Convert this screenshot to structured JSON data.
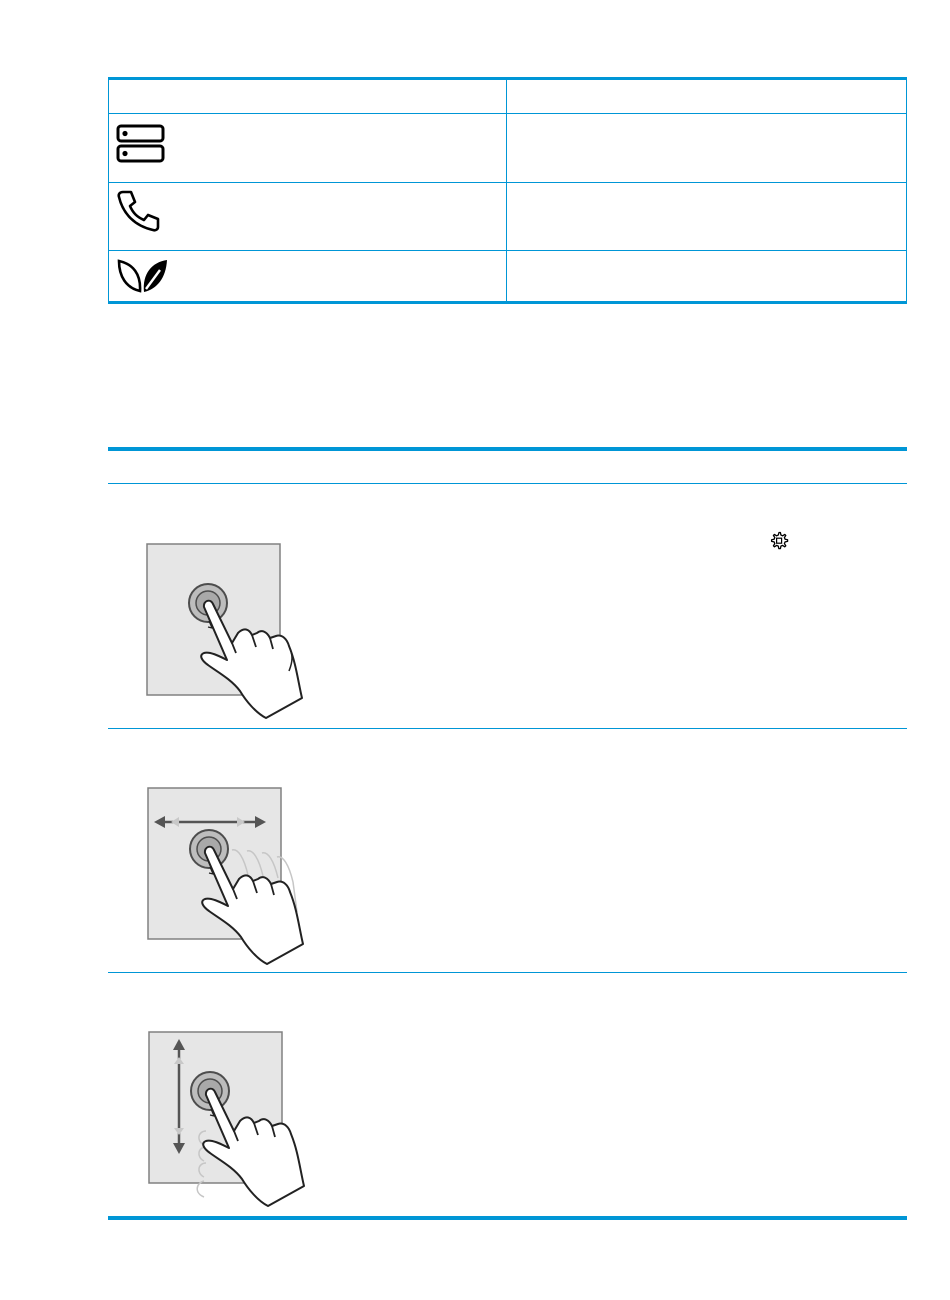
{
  "table_1": {
    "rows": [
      {
        "icon": "device-list-icon"
      },
      {
        "icon": "phone-icon"
      },
      {
        "icon": "leaf-icon"
      }
    ]
  },
  "table_2": {
    "rows": [
      {
        "gesture": "touch-gesture",
        "inline_icon": "settings-gear-icon"
      },
      {
        "gesture": "swipe-horizontal-gesture"
      },
      {
        "gesture": "scroll-vertical-gesture"
      }
    ]
  },
  "colors": {
    "accent": "#0096d6",
    "panel": "#e6e6e6",
    "panel_border": "#808080"
  }
}
